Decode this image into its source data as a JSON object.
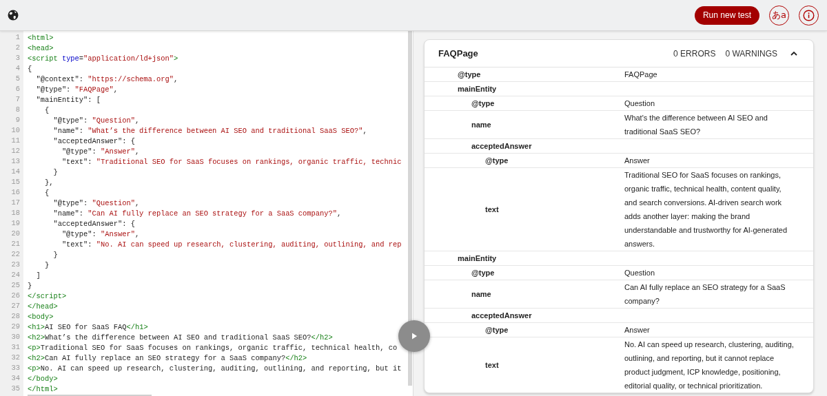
{
  "toolbar": {
    "run_button": "Run new test",
    "language_button": "あa"
  },
  "editor": {
    "lines": [
      {
        "number": "1",
        "tokens": [
          {
            "kind": "tag",
            "text": "<html>"
          }
        ]
      },
      {
        "number": "2",
        "tokens": [
          {
            "kind": "tag",
            "text": "<head>"
          }
        ]
      },
      {
        "number": "3",
        "tokens": [
          {
            "kind": "tag",
            "text": "<script "
          },
          {
            "kind": "attr",
            "text": "type"
          },
          {
            "kind": "plain",
            "text": "="
          },
          {
            "kind": "string",
            "text": "\"application/ld+json\""
          },
          {
            "kind": "tag",
            "text": ">"
          }
        ]
      },
      {
        "number": "4",
        "tokens": [
          {
            "kind": "plain",
            "text": "{"
          }
        ]
      },
      {
        "number": "5",
        "tokens": [
          {
            "kind": "plain",
            "text": "  \"@context\": "
          },
          {
            "kind": "string",
            "text": "\"https://schema.org\""
          },
          {
            "kind": "plain",
            "text": ","
          }
        ]
      },
      {
        "number": "6",
        "tokens": [
          {
            "kind": "plain",
            "text": "  \"@type\": "
          },
          {
            "kind": "string",
            "text": "\"FAQPage\""
          },
          {
            "kind": "plain",
            "text": ","
          }
        ]
      },
      {
        "number": "7",
        "tokens": [
          {
            "kind": "plain",
            "text": "  \"mainEntity\": ["
          }
        ]
      },
      {
        "number": "8",
        "tokens": [
          {
            "kind": "plain",
            "text": "    {"
          }
        ]
      },
      {
        "number": "9",
        "tokens": [
          {
            "kind": "plain",
            "text": "      \"@type\": "
          },
          {
            "kind": "string",
            "text": "\"Question\""
          },
          {
            "kind": "plain",
            "text": ","
          }
        ]
      },
      {
        "number": "10",
        "tokens": [
          {
            "kind": "plain",
            "text": "      \"name\": "
          },
          {
            "kind": "string",
            "text": "\"What’s the difference between AI SEO and traditional SaaS SEO?\""
          },
          {
            "kind": "plain",
            "text": ","
          }
        ]
      },
      {
        "number": "11",
        "tokens": [
          {
            "kind": "plain",
            "text": "      \"acceptedAnswer\": {"
          }
        ]
      },
      {
        "number": "12",
        "tokens": [
          {
            "kind": "plain",
            "text": "        \"@type\": "
          },
          {
            "kind": "string",
            "text": "\"Answer\""
          },
          {
            "kind": "plain",
            "text": ","
          }
        ]
      },
      {
        "number": "13",
        "tokens": [
          {
            "kind": "plain",
            "text": "        \"text\": "
          },
          {
            "kind": "string",
            "text": "\"Traditional SEO for SaaS focuses on rankings, organic traffic, technic"
          }
        ]
      },
      {
        "number": "14",
        "tokens": [
          {
            "kind": "plain",
            "text": "      }"
          }
        ]
      },
      {
        "number": "15",
        "tokens": [
          {
            "kind": "plain",
            "text": "    },"
          }
        ]
      },
      {
        "number": "16",
        "tokens": [
          {
            "kind": "plain",
            "text": "    {"
          }
        ]
      },
      {
        "number": "17",
        "tokens": [
          {
            "kind": "plain",
            "text": "      \"@type\": "
          },
          {
            "kind": "string",
            "text": "\"Question\""
          },
          {
            "kind": "plain",
            "text": ","
          }
        ]
      },
      {
        "number": "18",
        "tokens": [
          {
            "kind": "plain",
            "text": "      \"name\": "
          },
          {
            "kind": "string",
            "text": "\"Can AI fully replace an SEO strategy for a SaaS company?\""
          },
          {
            "kind": "plain",
            "text": ","
          }
        ]
      },
      {
        "number": "19",
        "tokens": [
          {
            "kind": "plain",
            "text": "      \"acceptedAnswer\": {"
          }
        ]
      },
      {
        "number": "20",
        "tokens": [
          {
            "kind": "plain",
            "text": "        \"@type\": "
          },
          {
            "kind": "string",
            "text": "\"Answer\""
          },
          {
            "kind": "plain",
            "text": ","
          }
        ]
      },
      {
        "number": "21",
        "tokens": [
          {
            "kind": "plain",
            "text": "        \"text\": "
          },
          {
            "kind": "string",
            "text": "\"No. AI can speed up research, clustering, auditing, outlining, and rep"
          }
        ]
      },
      {
        "number": "22",
        "tokens": [
          {
            "kind": "plain",
            "text": "      }"
          }
        ]
      },
      {
        "number": "23",
        "tokens": [
          {
            "kind": "plain",
            "text": "    }"
          }
        ]
      },
      {
        "number": "24",
        "tokens": [
          {
            "kind": "plain",
            "text": "  ]"
          }
        ]
      },
      {
        "number": "25",
        "tokens": [
          {
            "kind": "plain",
            "text": "}"
          }
        ]
      },
      {
        "number": "26",
        "tokens": [
          {
            "kind": "tag",
            "text": "</script>"
          }
        ]
      },
      {
        "number": "27",
        "tokens": [
          {
            "kind": "tag",
            "text": "</head>"
          }
        ]
      },
      {
        "number": "28",
        "tokens": [
          {
            "kind": "tag",
            "text": "<body>"
          }
        ]
      },
      {
        "number": "29",
        "tokens": [
          {
            "kind": "tag",
            "text": "<h1>"
          },
          {
            "kind": "plain",
            "text": "AI SEO for SaaS FAQ"
          },
          {
            "kind": "tag",
            "text": "</h1>"
          }
        ]
      },
      {
        "number": "30",
        "tokens": [
          {
            "kind": "tag",
            "text": "<h2>"
          },
          {
            "kind": "plain",
            "text": "What’s the difference between AI SEO and traditional SaaS SEO?"
          },
          {
            "kind": "tag",
            "text": "</h2>"
          }
        ]
      },
      {
        "number": "31",
        "tokens": [
          {
            "kind": "tag",
            "text": "<p>"
          },
          {
            "kind": "plain",
            "text": "Traditional SEO for SaaS focuses on rankings, organic traffic, technical health, co"
          }
        ]
      },
      {
        "number": "32",
        "tokens": [
          {
            "kind": "tag",
            "text": "<h2>"
          },
          {
            "kind": "plain",
            "text": "Can AI fully replace an SEO strategy for a SaaS company?"
          },
          {
            "kind": "tag",
            "text": "</h2>"
          }
        ]
      },
      {
        "number": "33",
        "tokens": [
          {
            "kind": "tag",
            "text": "<p>"
          },
          {
            "kind": "plain",
            "text": "No. AI can speed up research, clustering, auditing, outlining, and reporting, but it"
          }
        ]
      },
      {
        "number": "34",
        "tokens": [
          {
            "kind": "tag",
            "text": "</body>"
          }
        ]
      },
      {
        "number": "35",
        "tokens": [
          {
            "kind": "tag",
            "text": "</html>"
          }
        ]
      }
    ]
  },
  "result_card": {
    "title": "FAQPage",
    "errors": "0 ERRORS",
    "warnings": "0 WARNINGS",
    "expanded": true,
    "properties": [
      {
        "key": "@type",
        "value": "FAQPage"
      },
      {
        "key": "mainEntity",
        "children": [
          {
            "key": "@type",
            "value": "Question"
          },
          {
            "key": "name",
            "value": "What's the difference between AI SEO and traditional SaaS SEO?"
          },
          {
            "key": "acceptedAnswer",
            "children": [
              {
                "key": "@type",
                "value": "Answer"
              },
              {
                "key": "text",
                "value": "Traditional SEO for SaaS focuses on rankings, organic traffic, technical health, content quality, and search conversions. AI-driven search work adds another layer: making the brand understandable and trustworthy for AI-generated answers."
              }
            ]
          }
        ]
      },
      {
        "key": "mainEntity",
        "children": [
          {
            "key": "@type",
            "value": "Question"
          },
          {
            "key": "name",
            "value": "Can AI fully replace an SEO strategy for a SaaS company?"
          },
          {
            "key": "acceptedAnswer",
            "children": [
              {
                "key": "@type",
                "value": "Answer"
              },
              {
                "key": "text",
                "value": "No. AI can speed up research, clustering, auditing, outlining, and reporting, but it cannot replace product judgment, ICP knowledge, positioning, editorial quality, or technical prioritization."
              }
            ]
          }
        ]
      }
    ]
  }
}
